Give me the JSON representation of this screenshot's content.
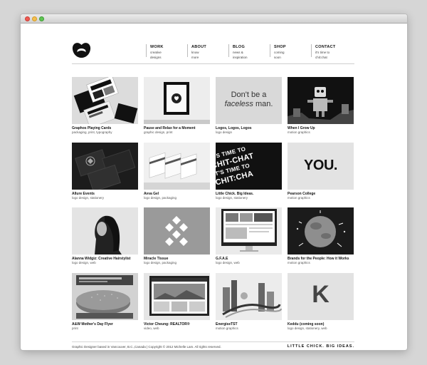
{
  "nav": [
    {
      "title": "WORK",
      "sub": "creative designs"
    },
    {
      "title": "ABOUT",
      "sub": "know more"
    },
    {
      "title": "BLOG",
      "sub": "news & inspiration"
    },
    {
      "title": "SHOP",
      "sub": "coming soon"
    },
    {
      "title": "CONTACT",
      "sub": "it's time to chit:chat"
    }
  ],
  "thumb_text": {
    "faceless_line1": "Don't be a",
    "faceless_line2a": "faceless",
    "faceless_line2b": " man.",
    "you": "YOU.",
    "chitchat_1": "IT'S TIME TO",
    "chitchat_2": "CHIT-CHAT",
    "chitchat_3": "IT'S TIME TO",
    "chitchat_4": "CHIT:CHA",
    "k": "K"
  },
  "portfolio": [
    {
      "title": "Graphos Playing Cards",
      "sub": "packaging, print, typography"
    },
    {
      "title": "Pause and Relax for a Moment",
      "sub": "graphic design, print"
    },
    {
      "title": "Logos, Logos, Logos",
      "sub": "logo design"
    },
    {
      "title": "When I Grow Up",
      "sub": "motion graphics"
    },
    {
      "title": "Allure Events",
      "sub": "logo design, stationery"
    },
    {
      "title": "Avva Gel",
      "sub": "logo design, packaging"
    },
    {
      "title": "Little Chick. Big Ideas.",
      "sub": "logo design, stationery"
    },
    {
      "title": "Pearson College",
      "sub": "motion graphics"
    },
    {
      "title": "Alanna Widgiz: Creative Hairstylist",
      "sub": "logo design, web"
    },
    {
      "title": "Miracle Tissue",
      "sub": "logo design, packaging"
    },
    {
      "title": "G.F.A.E",
      "sub": "logo design, web"
    },
    {
      "title": "Brands for the People: How it Works",
      "sub": "motion graphics"
    },
    {
      "title": "A&W Mother's Day Flyer",
      "sub": "print"
    },
    {
      "title": "Victor Cheung: REALTOR®",
      "sub": "video, web"
    },
    {
      "title": "EnergiseTST",
      "sub": "motion graphics"
    },
    {
      "title": "Keddu (coming soon)",
      "sub": "logo design, stationery, web"
    }
  ],
  "footer": {
    "left": "Graphic Designer based in Vancouver, B.C.,Canada | Copyright © 2012 Michelle Lam. All rights reserved.",
    "right": "LITTLE CHICK. BIG IDEAS."
  }
}
